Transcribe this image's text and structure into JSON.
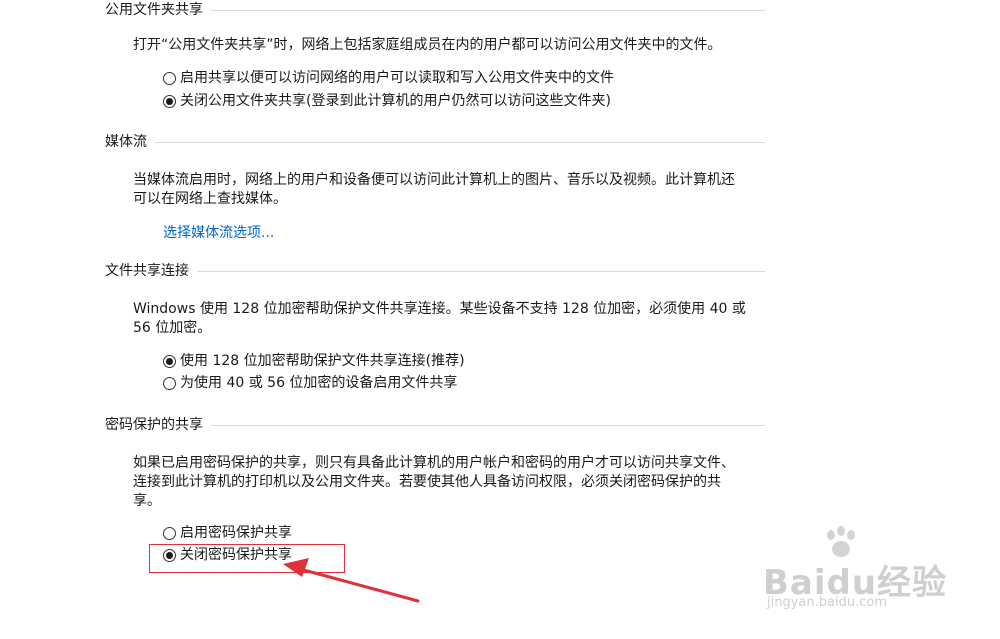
{
  "public_folder": {
    "title": "公用文件夹共享",
    "description": "打开“公用文件夹共享”时，网络上包括家庭组成员在内的用户都可以访问公用文件夹中的文件。",
    "options": [
      {
        "label": "启用共享以便可以访问网络的用户可以读取和写入公用文件夹中的文件",
        "checked": false
      },
      {
        "label": "关闭公用文件夹共享(登录到此计算机的用户仍然可以访问这些文件夹)",
        "checked": true
      }
    ]
  },
  "media_streaming": {
    "title": "媒体流",
    "description_line1": "当媒体流启用时，网络上的用户和设备便可以访问此计算机上的图片、音乐以及视频。此计算机还",
    "description_line2": "可以在网络上查找媒体。",
    "link_label": "选择媒体流选项..."
  },
  "file_sharing_connections": {
    "title": "文件共享连接",
    "description_line1": "Windows 使用 128 位加密帮助保护文件共享连接。某些设备不支持 128 位加密，必须使用 40 或",
    "description_line2": "56 位加密。",
    "options": [
      {
        "label": "使用 128 位加密帮助保护文件共享连接(推荐)",
        "checked": true
      },
      {
        "label": "为使用 40 或 56 位加密的设备启用文件共享",
        "checked": false
      }
    ]
  },
  "password_protected_sharing": {
    "title": "密码保护的共享",
    "description_line1": "如果已启用密码保护的共享，则只有具备此计算机的用户帐户和密码的用户才可以访问共享文件、",
    "description_line2": "连接到此计算机的打印机以及公用文件夹。若要使其他人具备访问权限，必须关闭密码保护的共",
    "description_line3": "享。",
    "options": [
      {
        "label": "启用密码保护共享",
        "checked": false
      },
      {
        "label": "关闭密码保护共享",
        "checked": true
      }
    ]
  },
  "annotation": {
    "highlight_color": "#e0303a"
  },
  "watermark": {
    "brand": "Baidu经验",
    "url": "jingyan.baidu.com"
  }
}
